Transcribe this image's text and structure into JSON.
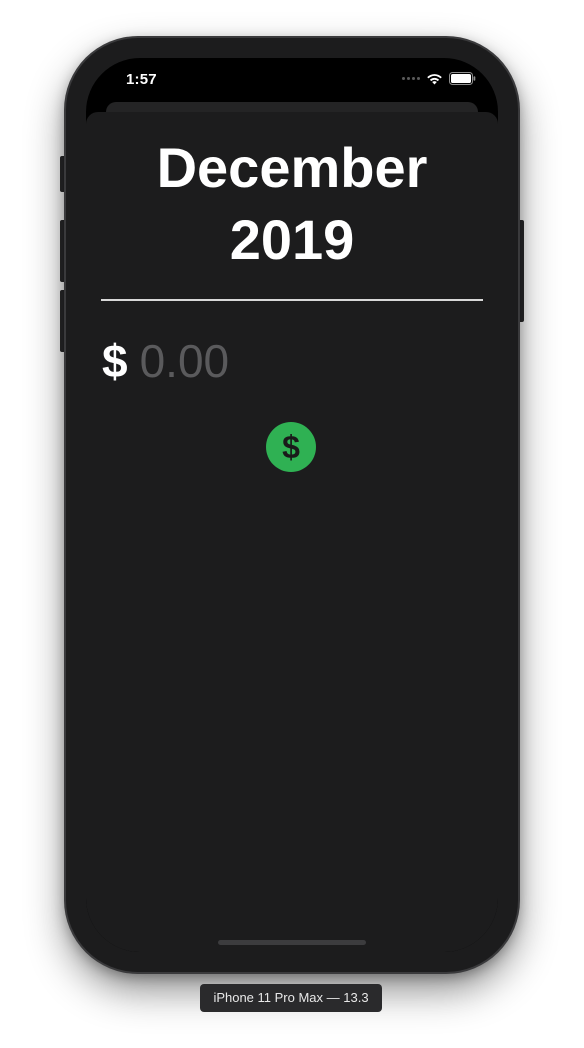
{
  "status_bar": {
    "time": "1:57"
  },
  "screen": {
    "title": "December\n2019",
    "currency_symbol": "$",
    "amount_placeholder": "0.00",
    "add_button_icon": "dollar-icon",
    "add_button_label": "$"
  },
  "simulator": {
    "device_label": "iPhone 11 Pro Max — 13.3"
  },
  "colors": {
    "accent_green": "#2fb153",
    "background": "#1c1c1d",
    "placeholder": "#5a5a5c"
  }
}
